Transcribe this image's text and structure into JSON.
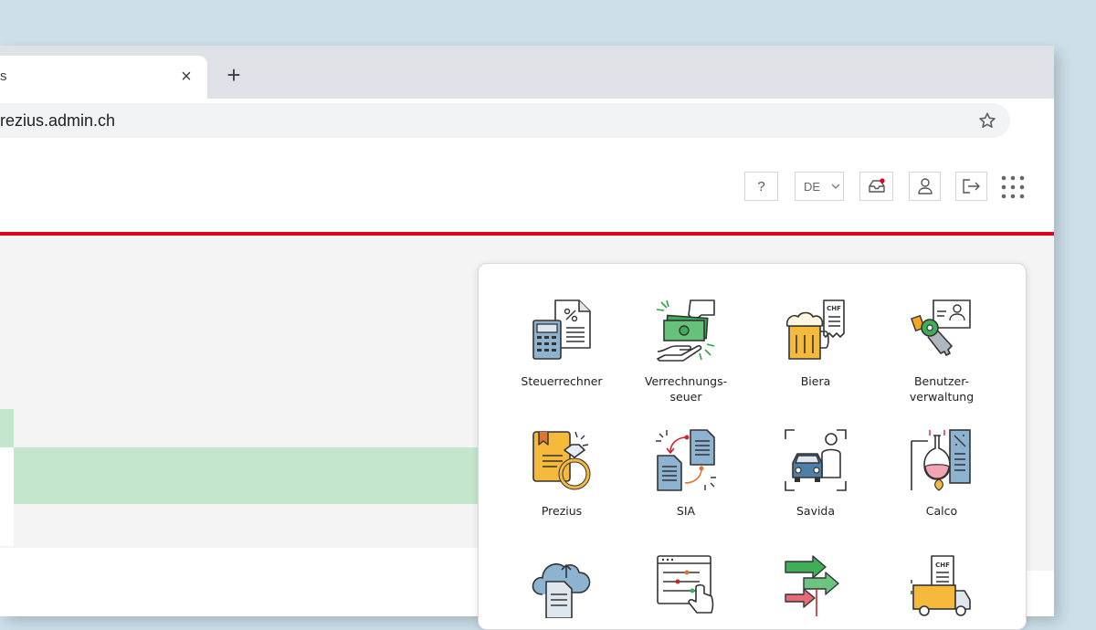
{
  "browser": {
    "tab": {
      "title": "s",
      "close_symbol": "×"
    },
    "new_tab_symbol": "+",
    "url": "rezius.admin.ch"
  },
  "header": {
    "help_label": "?",
    "language": {
      "selected": "DE"
    },
    "icons": [
      "help-icon",
      "chevron-down-icon",
      "inbox-icon",
      "user-icon",
      "logout-icon",
      "app-grid-icon"
    ],
    "accent_color": "#e0001b",
    "notification_color": "#e0001b"
  },
  "apps": {
    "items": [
      {
        "label": "Steuerrechner",
        "icon": "calculator-document-icon"
      },
      {
        "label": "Verrechnungs-\nseuer",
        "icon": "money-handover-icon"
      },
      {
        "label": "Biera",
        "icon": "beer-invoice-icon"
      },
      {
        "label": "Benutzer-\nverwaltung",
        "icon": "key-badge-icon"
      },
      {
        "label": "Prezius",
        "icon": "ring-certificate-icon"
      },
      {
        "label": "SIA",
        "icon": "document-exchange-icon"
      },
      {
        "label": "Savida",
        "icon": "car-person-icon"
      },
      {
        "label": "Calco",
        "icon": "flask-document-icon"
      },
      {
        "label": "",
        "icon": "cloud-upload-icon"
      },
      {
        "label": "",
        "icon": "form-click-icon"
      },
      {
        "label": "",
        "icon": "arrows-flow-icon"
      },
      {
        "label": "",
        "icon": "truck-invoice-icon"
      }
    ]
  },
  "content": {
    "highlight_color": "#c3e6cd"
  }
}
